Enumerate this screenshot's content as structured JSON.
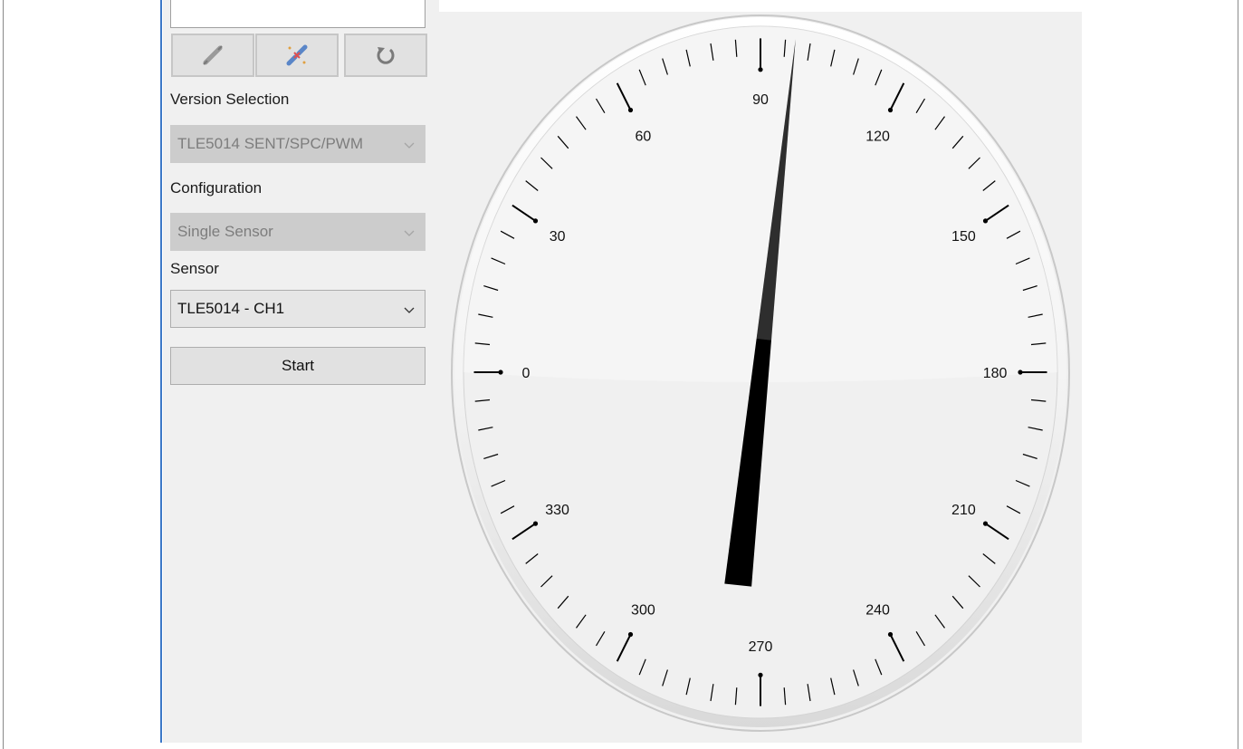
{
  "toolbar": {
    "buttons": [
      {
        "icon": "connect-icon"
      },
      {
        "icon": "disconnect-icon"
      },
      {
        "icon": "refresh-icon"
      }
    ]
  },
  "version_selection": {
    "label": "Version Selection",
    "value": "TLE5014 SENT/SPC/PWM",
    "enabled": false
  },
  "configuration": {
    "label": "Configuration",
    "value": "Single Sensor",
    "enabled": false
  },
  "sensor": {
    "label": "Sensor",
    "value": "TLE5014 - CH1",
    "enabled": true
  },
  "start_label": "Start",
  "gauge": {
    "min": 0,
    "max": 360,
    "major_step": 30,
    "minor_step": 5,
    "tick_labels": [
      "0",
      "30",
      "60",
      "90",
      "120",
      "150",
      "180",
      "210",
      "240",
      "270",
      "300",
      "330"
    ],
    "needle_value": 97,
    "colors": {
      "needle": "#000000",
      "dial_face": "#f0f0f0",
      "bezel": "#ffffff"
    }
  }
}
